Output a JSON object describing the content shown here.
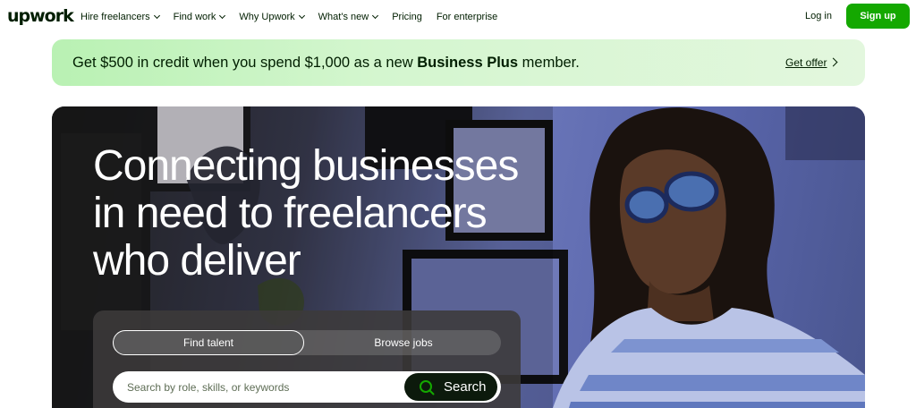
{
  "nav": {
    "logo": "upwork",
    "links": [
      {
        "label": "Hire freelancers",
        "dropdown": true
      },
      {
        "label": "Find work",
        "dropdown": true
      },
      {
        "label": "Why Upwork",
        "dropdown": true
      },
      {
        "label": "What's new",
        "dropdown": true
      },
      {
        "label": "Pricing",
        "dropdown": false
      },
      {
        "label": "For enterprise",
        "dropdown": false
      }
    ],
    "login": "Log in",
    "signup": "Sign up"
  },
  "promo": {
    "text_before": "Get $500 in credit when you spend $1,000 as a new ",
    "text_bold": "Business Plus",
    "text_after": " member.",
    "cta": "Get offer"
  },
  "hero": {
    "title_lines": [
      "Connecting businesses",
      "in need to freelancers",
      "who deliver"
    ],
    "tabs": {
      "active": "Find talent",
      "inactive": "Browse jobs"
    },
    "search": {
      "placeholder": "Search by role, skills, or keywords",
      "button": "Search"
    }
  },
  "colors": {
    "brand_green": "#14a800",
    "promo_green": "#b9f1b3",
    "text_dark": "#001e00"
  }
}
